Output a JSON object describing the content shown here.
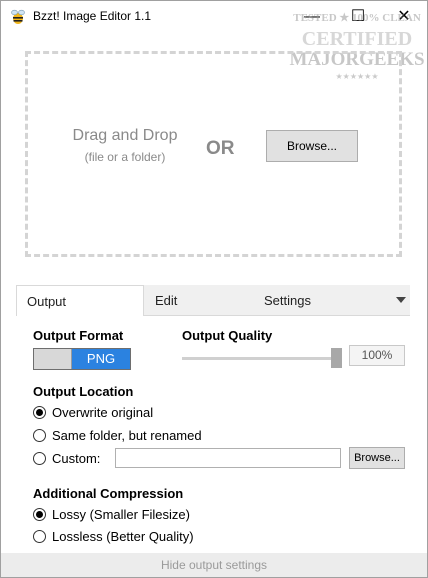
{
  "window": {
    "title": "Bzzt! Image Editor 1.1",
    "min_glyph": "—",
    "max_glyph": "☐",
    "close_glyph": "✕"
  },
  "watermark": {
    "line1": "TESTED ★ 100% CLEAN",
    "line2": "CERTIFIED",
    "line3": "MAJORGEEKS",
    "line4": "★★★★★★"
  },
  "dropzone": {
    "drag_text": "Drag and Drop",
    "drag_sub": "(file or a folder)",
    "or_text": "OR",
    "browse_label": "Browse..."
  },
  "tabs": {
    "output": "Output",
    "edit": "Edit",
    "settings": "Settings",
    "active": "Output"
  },
  "output": {
    "format_label": "Output Format",
    "format_value": "PNG",
    "quality_label": "Output Quality",
    "quality_value": "100%",
    "quality_level": 100,
    "location_label": "Output Location",
    "location_options": [
      {
        "label": "Overwrite original",
        "checked": true
      },
      {
        "label": "Same folder, but renamed",
        "checked": false
      },
      {
        "label": "Custom:",
        "checked": false
      }
    ],
    "custom_path": "",
    "browse_label": "Browse...",
    "compression_label": "Additional Compression",
    "compression_options": [
      {
        "label": "Lossy (Smaller Filesize)",
        "checked": true
      },
      {
        "label": "Lossless (Better Quality)",
        "checked": false
      }
    ]
  },
  "footer": {
    "hide_label": "Hide output settings"
  },
  "colors": {
    "accent": "#2b82e0",
    "dash_border": "#d4d4d4",
    "muted_text": "#8a8a8a"
  }
}
